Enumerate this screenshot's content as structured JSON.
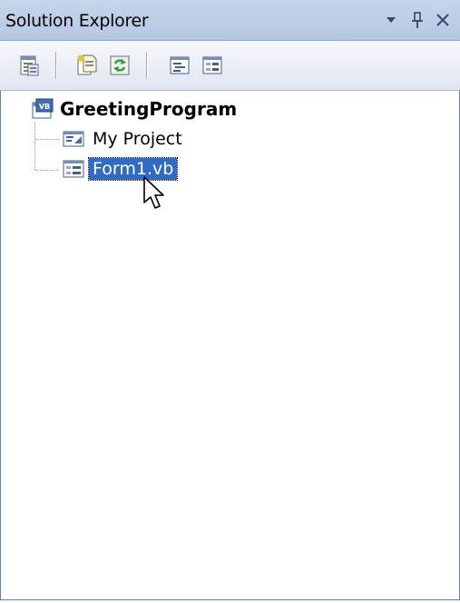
{
  "panel": {
    "title": "Solution Explorer",
    "title_buttons": [
      "dropdown-arrow-icon",
      "pin-icon",
      "close-icon"
    ]
  },
  "toolbar": {
    "buttons": [
      "properties-icon",
      "show-all-files-icon",
      "refresh-icon",
      "view-code-icon",
      "view-designer-icon"
    ]
  },
  "tree": {
    "root": {
      "label": "GreetingProgram",
      "icon": "vb-project-icon"
    },
    "children": [
      {
        "label": "My Project",
        "icon": "my-project-icon",
        "selected": false
      },
      {
        "label": "Form1.vb",
        "icon": "form-file-icon",
        "selected": true
      }
    ]
  },
  "colors": {
    "titlebar": "#c8d5ea",
    "selection": "#316ac5",
    "border": "#6b7f9e"
  }
}
